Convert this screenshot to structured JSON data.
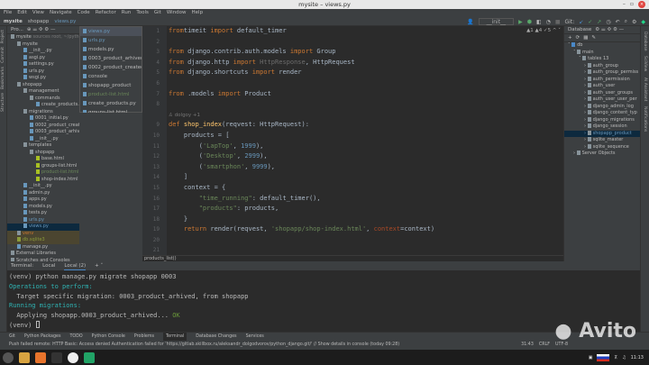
{
  "window": {
    "title": "mysite – views.py"
  },
  "menu": [
    "File",
    "Edit",
    "View",
    "Navigate",
    "Code",
    "Refactor",
    "Run",
    "Tools",
    "Git",
    "Window",
    "Help"
  ],
  "breadcrumb": [
    "mysite",
    "shopapp",
    "views.py"
  ],
  "toolbar": {
    "run_config": "__init__",
    "git_label": "Git:"
  },
  "left_strip": [
    "Project",
    "Commit",
    "Bookmarks",
    "Structure"
  ],
  "project": {
    "title": "Pro...",
    "tree": [
      {
        "t": "mysite",
        "d": 0,
        "k": "dir",
        "note": "sources root, ~/python_django"
      },
      {
        "t": "mysite",
        "d": 1,
        "k": "dir"
      },
      {
        "t": "__init__.py",
        "d": 2,
        "k": "py"
      },
      {
        "t": "asgi.py",
        "d": 2,
        "k": "py"
      },
      {
        "t": "settings.py",
        "d": 2,
        "k": "py"
      },
      {
        "t": "urls.py",
        "d": 2,
        "k": "py"
      },
      {
        "t": "wsgi.py",
        "d": 2,
        "k": "py"
      },
      {
        "t": "shopapp",
        "d": 1,
        "k": "dir"
      },
      {
        "t": "management",
        "d": 2,
        "k": "dir"
      },
      {
        "t": "commands",
        "d": 3,
        "k": "dir"
      },
      {
        "t": "create_products.py",
        "d": 4,
        "k": "py"
      },
      {
        "t": "migrations",
        "d": 2,
        "k": "dir"
      },
      {
        "t": "0001_initial.py",
        "d": 3,
        "k": "py"
      },
      {
        "t": "0002_product_created",
        "d": 3,
        "k": "py"
      },
      {
        "t": "0003_product_arhived",
        "d": 3,
        "k": "py"
      },
      {
        "t": "__init__.py",
        "d": 3,
        "k": "py"
      },
      {
        "t": "templates",
        "d": 2,
        "k": "dir"
      },
      {
        "t": "shopapp",
        "d": 3,
        "k": "dir"
      },
      {
        "t": "base.html",
        "d": 4,
        "k": "html"
      },
      {
        "t": "groups-list.html",
        "d": 4,
        "k": "html"
      },
      {
        "t": "product-list.html",
        "d": 4,
        "k": "html",
        "c": "#6a8759"
      },
      {
        "t": "shop-index.html",
        "d": 4,
        "k": "html"
      },
      {
        "t": "__init__.py",
        "d": 2,
        "k": "py"
      },
      {
        "t": "admin.py",
        "d": 2,
        "k": "py"
      },
      {
        "t": "apps.py",
        "d": 2,
        "k": "py"
      },
      {
        "t": "models.py",
        "d": 2,
        "k": "py"
      },
      {
        "t": "tests.py",
        "d": 2,
        "k": "py"
      },
      {
        "t": "urls.py",
        "d": 2,
        "k": "py",
        "c": "#6897bb"
      },
      {
        "t": "views.py",
        "d": 2,
        "k": "py",
        "sel": true
      },
      {
        "t": "venv",
        "d": 1,
        "k": "dir",
        "c": "#cc7832",
        "hl": true
      },
      {
        "t": "db.sqlite3",
        "d": 1,
        "k": "db",
        "c": "#8a9a3a",
        "hl": true
      },
      {
        "t": "manage.py",
        "d": 1,
        "k": "py"
      },
      {
        "t": "External Libraries",
        "d": 0,
        "k": "lib"
      },
      {
        "t": "Scratches and Consoles",
        "d": 0,
        "k": "lib"
      }
    ]
  },
  "recent_files": [
    {
      "t": "views.py",
      "c": "#6897bb",
      "sel": true
    },
    {
      "t": "urls.py",
      "c": "#6897bb"
    },
    {
      "t": "models.py"
    },
    {
      "t": "0003_product_arhived"
    },
    {
      "t": "0002_product_created"
    },
    {
      "t": "console"
    },
    {
      "t": "shopapp_product"
    },
    {
      "t": "product-list.html",
      "c": "#6a8759"
    },
    {
      "t": "create_products.py"
    },
    {
      "t": "groups-list.html"
    }
  ],
  "editor": {
    "inspections": "▲1 ▲4 ✓5 ^ ˅",
    "lines": [
      {
        "n": "1",
        "tokens": [
          [
            "kw",
            "from"
          ],
          [
            "",
            "timeit "
          ],
          [
            "kw",
            "import"
          ],
          [
            "",
            " default_timer"
          ]
        ]
      },
      {
        "n": "2",
        "tokens": []
      },
      {
        "n": "3",
        "tokens": [
          [
            "kw",
            "from"
          ],
          [
            "",
            " django.contrib.auth.models "
          ],
          [
            "kw",
            "import"
          ],
          [
            "",
            " Group"
          ]
        ]
      },
      {
        "n": "4",
        "tokens": [
          [
            "kw",
            "from"
          ],
          [
            "",
            " django.http "
          ],
          [
            "kw",
            "import"
          ],
          [
            "imp",
            " HttpResponse"
          ],
          [
            "",
            ", HttpRequest"
          ]
        ]
      },
      {
        "n": "5",
        "tokens": [
          [
            "kw",
            "from"
          ],
          [
            "",
            " django.shortcuts "
          ],
          [
            "kw",
            "import"
          ],
          [
            "",
            " render"
          ]
        ]
      },
      {
        "n": "6",
        "tokens": []
      },
      {
        "n": "7",
        "tokens": [
          [
            "kw",
            "from"
          ],
          [
            "",
            " .models "
          ],
          [
            "kw",
            "import"
          ],
          [
            "",
            " Product"
          ]
        ]
      },
      {
        "n": "8",
        "tokens": []
      },
      {
        "n": "",
        "tokens": [
          [
            "hint",
            "♙ dolgoy +1"
          ]
        ]
      },
      {
        "n": "9",
        "tokens": [
          [
            "kw",
            "def"
          ],
          [
            "fn",
            " shop_index"
          ],
          [
            "",
            "(reqvest: HttpRequest):"
          ]
        ]
      },
      {
        "n": "10",
        "tokens": [
          [
            "",
            "    products = ["
          ]
        ]
      },
      {
        "n": "11",
        "tokens": [
          [
            "",
            "        ("
          ],
          [
            "str",
            "'LapTop'"
          ],
          [
            "",
            ", "
          ],
          [
            "num",
            "1999"
          ],
          [
            "",
            "),"
          ]
        ]
      },
      {
        "n": "12",
        "tokens": [
          [
            "",
            "        ("
          ],
          [
            "str",
            "'Desktop'"
          ],
          [
            "",
            ", "
          ],
          [
            "num",
            "2999"
          ],
          [
            "",
            "),"
          ]
        ]
      },
      {
        "n": "13",
        "tokens": [
          [
            "",
            "        ("
          ],
          [
            "str",
            "'smartphon'"
          ],
          [
            "",
            ", "
          ],
          [
            "num",
            "9999"
          ],
          [
            "",
            "),"
          ]
        ]
      },
      {
        "n": "14",
        "tokens": [
          [
            "",
            "    ]"
          ]
        ]
      },
      {
        "n": "15",
        "tokens": [
          [
            "",
            "    context = {"
          ]
        ]
      },
      {
        "n": "16",
        "tokens": [
          [
            "",
            "        "
          ],
          [
            "str",
            "\"time_running\""
          ],
          [
            "",
            ": default_timer(),"
          ]
        ]
      },
      {
        "n": "17",
        "tokens": [
          [
            "",
            "        "
          ],
          [
            "str",
            "\"products\""
          ],
          [
            "",
            ": products,"
          ]
        ]
      },
      {
        "n": "18",
        "tokens": [
          [
            "",
            "    }"
          ]
        ]
      },
      {
        "n": "19",
        "tokens": [
          [
            "kw",
            "    return"
          ],
          [
            "",
            " render(reqvest, "
          ],
          [
            "str",
            "'shopapp/shop-index.html'"
          ],
          [
            "",
            ", "
          ],
          [
            "par",
            "context"
          ],
          [
            "",
            "=context)"
          ]
        ]
      },
      {
        "n": "20",
        "tokens": []
      },
      {
        "n": "21",
        "tokens": []
      }
    ],
    "breadcrumb": "products_list()"
  },
  "database": {
    "title": "Database",
    "tree": [
      {
        "t": "db",
        "d": 0
      },
      {
        "t": "main",
        "d": 1
      },
      {
        "t": "tables 13",
        "d": 2
      },
      {
        "t": "auth_group",
        "d": 3
      },
      {
        "t": "auth_group_permiss",
        "d": 3
      },
      {
        "t": "auth_permission",
        "d": 3
      },
      {
        "t": "auth_user",
        "d": 3
      },
      {
        "t": "auth_user_groups",
        "d": 3
      },
      {
        "t": "auth_user_user_per",
        "d": 3
      },
      {
        "t": "django_admin_log",
        "d": 3
      },
      {
        "t": "django_content_typ",
        "d": 3
      },
      {
        "t": "django_migrations",
        "d": 3
      },
      {
        "t": "django_session",
        "d": 3
      },
      {
        "t": "shopapp_product",
        "d": 3,
        "sel": true
      },
      {
        "t": "sqlite_master",
        "d": 3
      },
      {
        "t": "sqlite_sequence",
        "d": 3
      },
      {
        "t": "Server Objects",
        "d": 1
      }
    ]
  },
  "right_strip": [
    "Database",
    "SciView",
    "AI Assistant",
    "Notifications"
  ],
  "terminal": {
    "tabs": [
      "Terminal:",
      "Local",
      "Local (2)"
    ],
    "lines": [
      [
        [
          "",
          "(venv) python manage.py migrate shopapp 0003"
        ]
      ],
      [
        [
          "cyan",
          "Operations to perform:"
        ]
      ],
      [
        [
          "",
          "  Target specific migration: 0003_product_arhived, from shopapp"
        ]
      ],
      [
        [
          "cyan",
          "Running migrations:"
        ]
      ],
      [
        [
          "",
          "  Applying shopapp.0003_product_arhived... "
        ],
        [
          "green",
          "OK"
        ]
      ],
      [
        [
          "",
          "(venv) "
        ]
      ]
    ]
  },
  "tool_windows": [
    "Git",
    "Python Packages",
    "TODO",
    "Python Console",
    "Problems",
    "Terminal",
    "Database Changes",
    "Services"
  ],
  "status": {
    "message": "Push failed remote: HTTP Basic: Access denied Authentication failed for 'https://gitlab.skillbox.ru/aleksandr_dolgodvorov/python_django.git/' // Show details in console (today 09:28)",
    "position": "31:43",
    "line_sep": "CRLF",
    "encoding": "UTF-8"
  },
  "taskbar": {
    "clock": "11:13"
  },
  "watermark": "Avito"
}
